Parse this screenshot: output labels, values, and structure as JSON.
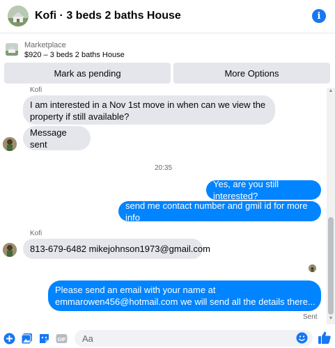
{
  "header": {
    "title": "Kofi · 3 beds 2 baths House",
    "info_icon": "info-icon"
  },
  "marketplace": {
    "label": "Marketplace",
    "listing": "$920 – 3 beds 2 baths House",
    "mark_pending_label": "Mark as pending",
    "more_options_label": "More Options"
  },
  "chat": {
    "cut_sender": "Kofi",
    "messages": [
      {
        "dir": "in",
        "text_lines": [
          "I am interested in a Nov 1st move in when can we view the",
          "property if still available?"
        ]
      },
      {
        "dir": "in",
        "text": "Message sent"
      },
      {
        "dir": "out",
        "text": "Yes, are you still interested?"
      },
      {
        "dir": "out",
        "text": "send me contact number and gmil id for more info"
      },
      {
        "dir": "in",
        "text": "813-679-6482 mikejohnson1973@gmail.com"
      },
      {
        "dir": "out",
        "text_lines": [
          "Please send an email with your name at",
          "emmarowen456@hotmail.com we will send all the details there..."
        ]
      }
    ],
    "timestamp": "20:35",
    "sender_name": "Kofi",
    "sent_status": "Sent"
  },
  "composer": {
    "placeholder": "Aa",
    "icons": [
      "add-icon",
      "photo-icon",
      "sticker-icon",
      "gif-icon",
      "emoji-icon",
      "thumbs-up-icon"
    ],
    "gif_label": "GIF"
  },
  "colors": {
    "accent": "#0084ff",
    "brand_blue": "#1877f2",
    "incoming_bubble": "#e4e6eb",
    "button_bg": "#e4e6eb"
  }
}
